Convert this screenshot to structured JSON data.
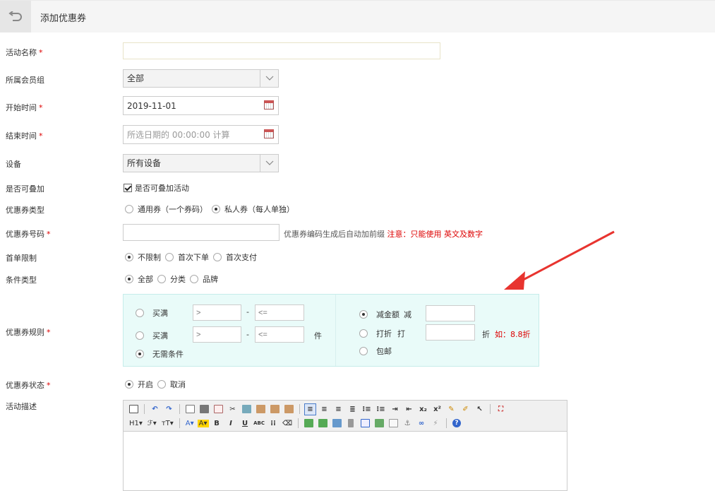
{
  "header": {
    "title": "添加优惠券"
  },
  "fields": {
    "name": {
      "label": "活动名称",
      "required": "*",
      "value": ""
    },
    "group": {
      "label": "所属会员组",
      "value": "全部"
    },
    "start": {
      "label": "开始时间",
      "required": "*",
      "value": "2019-11-01"
    },
    "end": {
      "label": "结束时间",
      "required": "*",
      "placeholder": "所选日期的 00:00:00 计算"
    },
    "device": {
      "label": "设备",
      "value": "所有设备"
    },
    "stackable": {
      "label": "是否可叠加",
      "checkbox_label": "是否可叠加活动",
      "checked": true
    },
    "coupon_type": {
      "label": "优惠券类型",
      "options": [
        "通用券（一个券码）",
        "私人券（每人单独）"
      ],
      "selected": 1
    },
    "coupon_code": {
      "label": "优惠券号码",
      "required": "*",
      "value": "",
      "hint": "优惠券编码生成后自动加前缀",
      "warning": "注意：只能使用 英文及数字"
    },
    "first_order": {
      "label": "首单限制",
      "options": [
        "不限制",
        "首次下单",
        "首次支付"
      ],
      "selected": 0
    },
    "condition_type": {
      "label": "条件类型",
      "options": [
        "全部",
        "分类",
        "品牌"
      ],
      "selected": 0
    },
    "rules": {
      "label": "优惠券规则",
      "required": "*",
      "left": {
        "row1_label": "买满",
        "row1_min_ph": ">",
        "row1_max_ph": "<=",
        "dash": "-",
        "row2_label": "买满",
        "row2_min_ph": ">",
        "row2_max_ph": "<=",
        "unit": "件",
        "row3_label": "无需条件",
        "selected": 2
      },
      "right": {
        "row1_label": "减金额",
        "row1_suffix": "减",
        "row2_label": "打折",
        "row2_suffix": "打",
        "row2_unit": "折",
        "row2_note": "如：8.8折",
        "row3_label": "包邮",
        "selected": 0
      }
    },
    "status": {
      "label": "优惠券状态",
      "required": "*",
      "options": [
        "开启",
        "取消"
      ],
      "selected": 0
    },
    "description": {
      "label": "活动描述",
      "toolbar_drops": [
        "H1",
        "ℱ",
        "тT"
      ]
    }
  },
  "colors": {
    "required": "#dd0000",
    "rules_bg": "#e9fbf9",
    "arrow": "#e8342f"
  }
}
